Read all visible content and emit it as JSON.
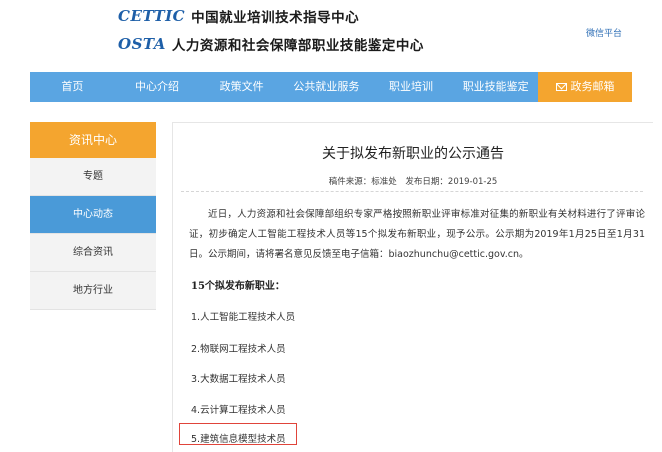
{
  "header": {
    "logo1_mark": "CETTIC",
    "logo1_text": "中国就业培训技术指导中心",
    "logo2_mark": "OSTA",
    "logo2_text": "人力资源和社会保障部职业技能鉴定中心",
    "wechat_link": "微信平台"
  },
  "nav": {
    "items": [
      "首页",
      "中心介绍",
      "政策文件",
      "公共就业服务",
      "职业培训",
      "职业技能鉴定"
    ],
    "mail": "政务邮箱",
    "colors": {
      "bar": "#5aa5e2",
      "mail": "#f4a52f"
    }
  },
  "sidebar": {
    "header": "资讯中心",
    "items": [
      "专题",
      "中心动态",
      "综合资讯",
      "地方行业"
    ],
    "active": "中心动态"
  },
  "article": {
    "title": "关于拟发布新职业的公示通告",
    "source": "稿件来源：标准处",
    "date": "发布日期：2019-01-25",
    "body": "近日，人力资源和社会保障部组织专家严格按照新职业评审标准对征集的新职业有关材料进行了评审论证，初步确定人工智能工程技术人员等15个拟发布新职业，现予公示。公示期为2019年1月25日至1月31日。公示期间，请将署名意见反馈至电子信箱：biaozhunchu@cettic.gov.cn。",
    "list_heading": "15个拟发布新职业：",
    "list": [
      "1.人工智能工程技术人员",
      "2.物联网工程技术人员",
      "3.大数据工程技术人员",
      "4.云计算工程技术人员",
      "5.建筑信息模型技术员"
    ]
  }
}
